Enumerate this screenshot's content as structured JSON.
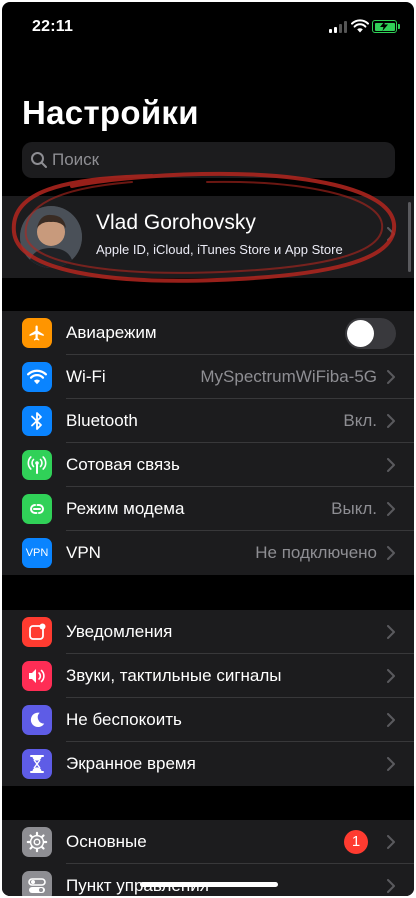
{
  "status_bar": {
    "time": "22:11"
  },
  "title": "Настройки",
  "search": {
    "placeholder": "Поиск"
  },
  "profile": {
    "name": "Vlad Gorohovsky",
    "subtitle": "Apple ID, iCloud, iTunes Store и App Store"
  },
  "group1": [
    {
      "label": "Авиарежим",
      "icon": "airplane-icon",
      "color": "#ff9500",
      "toggle": false
    },
    {
      "label": "Wi-Fi",
      "icon": "wifi-icon",
      "color": "#0a84ff",
      "value": "MySpectrumWiFiba-5G"
    },
    {
      "label": "Bluetooth",
      "icon": "bluetooth-icon",
      "color": "#0a84ff",
      "value": "Вкл."
    },
    {
      "label": "Сотовая связь",
      "icon": "antenna-icon",
      "color": "#30d158"
    },
    {
      "label": "Режим модема",
      "icon": "hotspot-icon",
      "color": "#30d158",
      "value": "Выкл."
    },
    {
      "label": "VPN",
      "icon": "vpn-icon",
      "icon_text": "VPN",
      "color": "#0a84ff",
      "value": "Не подключено"
    }
  ],
  "group2": [
    {
      "label": "Уведомления",
      "icon": "notifications-icon",
      "color": "#ff3b30"
    },
    {
      "label": "Звуки, тактильные сигналы",
      "icon": "speaker-icon",
      "color": "#ff2d55"
    },
    {
      "label": "Не беспокоить",
      "icon": "moon-icon",
      "color": "#5e5ce6"
    },
    {
      "label": "Экранное время",
      "icon": "hourglass-icon",
      "color": "#5e5ce6"
    }
  ],
  "group3": [
    {
      "label": "Основные",
      "icon": "gear-icon",
      "color": "#8e8e93",
      "badge": "1"
    },
    {
      "label": "Пункт управления",
      "icon": "control-center-icon",
      "color": "#8e8e93"
    }
  ]
}
